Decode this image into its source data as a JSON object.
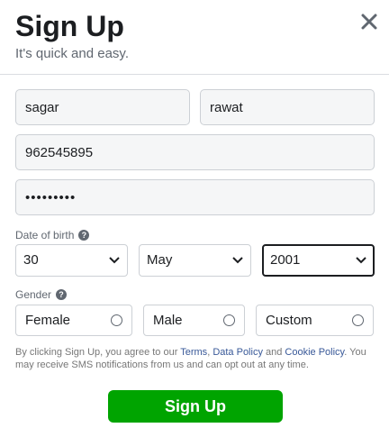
{
  "header": {
    "title": "Sign Up",
    "subtitle": "It's quick and easy.",
    "close_icon": "close-icon"
  },
  "form": {
    "first_name": {
      "value": "sagar"
    },
    "surname": {
      "value": "rawat"
    },
    "mobile": {
      "value": "962545895"
    },
    "password": {
      "value": "sagar@123"
    }
  },
  "dob": {
    "label": "Date of birth",
    "help_glyph": "?",
    "day": "30",
    "month": "May",
    "year": "2001"
  },
  "gender": {
    "label": "Gender",
    "help_glyph": "?",
    "options": [
      "Female",
      "Male",
      "Custom"
    ]
  },
  "terms": {
    "prefix": "By clicking Sign Up, you agree to our ",
    "terms_link": "Terms",
    "sep1": ", ",
    "data_policy_link": "Data Policy",
    "sep2": " and ",
    "cookie_policy_link": "Cookie Policy",
    "suffix": ". You may receive SMS notifications from us and can opt out at any time."
  },
  "submit_label": "Sign Up",
  "colors": {
    "submit_green": "#00a400",
    "link_blue": "#385898",
    "field_bg": "#f5f6f7",
    "border": "#ccd0d5"
  }
}
